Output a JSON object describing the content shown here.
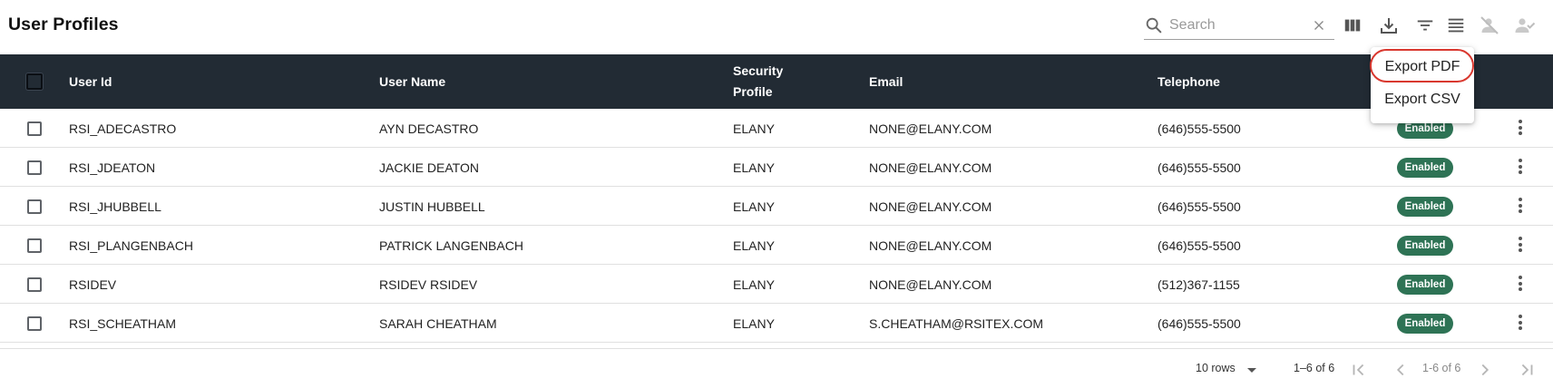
{
  "page": {
    "title": "User Profiles"
  },
  "search": {
    "placeholder": "Search",
    "value": ""
  },
  "toolbar": {
    "icons": [
      "columns-icon",
      "download-icon",
      "filter-icon",
      "density-icon",
      "person-off-icon",
      "person-check-icon"
    ]
  },
  "table": {
    "columns": {
      "user_id": "User Id",
      "user_name": "User Name",
      "security_profile_line1": "Security",
      "security_profile_line2": "Profile",
      "email": "Email",
      "telephone": "Telephone"
    },
    "rows": [
      {
        "user_id": "RSI_ADECASTRO",
        "user_name": "AYN DECASTRO",
        "security_profile": "ELANY",
        "email": "NONE@ELANY.COM",
        "telephone": "(646)555-5500",
        "status": "Enabled"
      },
      {
        "user_id": "RSI_JDEATON",
        "user_name": "JACKIE DEATON",
        "security_profile": "ELANY",
        "email": "NONE@ELANY.COM",
        "telephone": "(646)555-5500",
        "status": "Enabled"
      },
      {
        "user_id": "RSI_JHUBBELL",
        "user_name": "JUSTIN HUBBELL",
        "security_profile": "ELANY",
        "email": "NONE@ELANY.COM",
        "telephone": "(646)555-5500",
        "status": "Enabled"
      },
      {
        "user_id": "RSI_PLANGENBACH",
        "user_name": "PATRICK LANGENBACH",
        "security_profile": "ELANY",
        "email": "NONE@ELANY.COM",
        "telephone": "(646)555-5500",
        "status": "Enabled"
      },
      {
        "user_id": "RSIDEV",
        "user_name": "RSIDEV RSIDEV",
        "security_profile": "ELANY",
        "email": "NONE@ELANY.COM",
        "telephone": "(512)367-1155",
        "status": "Enabled"
      },
      {
        "user_id": "RSI_SCHEATHAM",
        "user_name": "SARAH CHEATHAM",
        "security_profile": "ELANY",
        "email": "S.CHEATHAM@RSITEX.COM",
        "telephone": "(646)555-5500",
        "status": "Enabled"
      }
    ]
  },
  "footer": {
    "rows_per_page": "10 rows",
    "range_text": "1–6 of 6",
    "page_text": "1-6 of 6"
  },
  "export_menu": {
    "items": [
      "Export PDF",
      "Export CSV"
    ],
    "highlighted": "Export PDF"
  },
  "colors": {
    "header_bg": "#222b34",
    "badge_bg": "#2e7355",
    "highlight_ring": "#d9382f"
  }
}
